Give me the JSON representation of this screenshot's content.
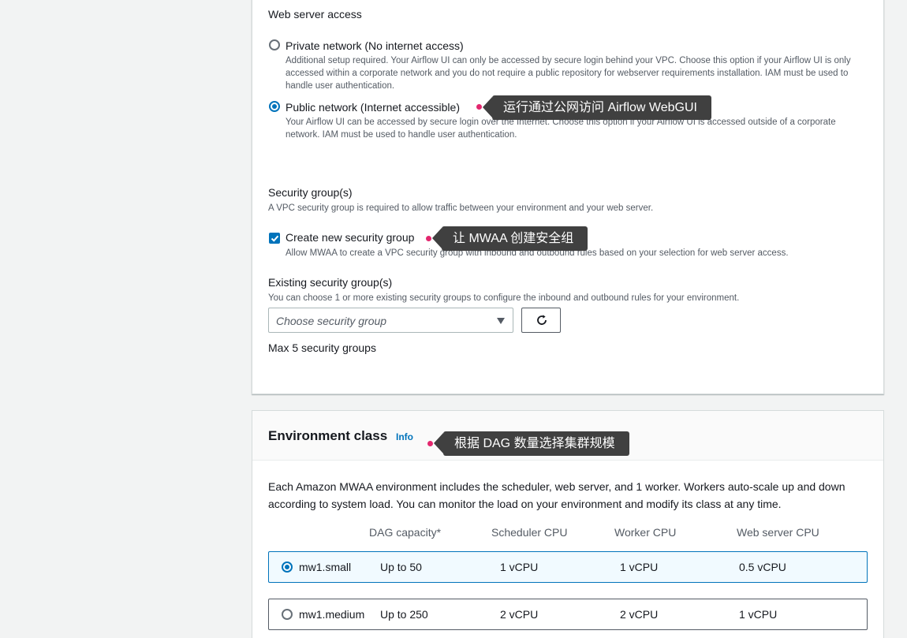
{
  "web_server_access": {
    "heading": "Web server access",
    "options": [
      {
        "label": "Private network (No internet access)",
        "description": "Additional setup required. Your Airflow UI can only be accessed by secure login behind your VPC. Choose this option if your Airflow UI is only accessed within a corporate network and you do not require a public repository for webserver requirements installation. IAM must be used to handle user authentication.",
        "selected": false
      },
      {
        "label": "Public network (Internet accessible)",
        "description": "Your Airflow UI can be accessed by secure login over the Internet. Choose this option if your Airflow UI is accessed outside of a corporate network. IAM must be used to handle user authentication.",
        "selected": true
      }
    ],
    "callout": "运行通过公网访问 Airflow WebGUI"
  },
  "security_groups": {
    "heading": "Security group(s)",
    "description": "A VPC security group is required to allow traffic between your environment and your web server.",
    "create_new": {
      "label": "Create new security group",
      "description": "Allow MWAA to create a VPC security group with inbound and outbound rules based on your selection for web server access.",
      "checked": true
    },
    "callout": "让 MWAA 创建安全组",
    "existing": {
      "heading": "Existing security group(s)",
      "description": "You can choose 1 or more existing security groups to configure the inbound and outbound rules for your environment.",
      "placeholder": "Choose security group",
      "refresh_icon": "refresh-icon",
      "caret_icon": "caret-down-icon",
      "max_note": "Max 5 security groups"
    }
  },
  "environment_class": {
    "title": "Environment class",
    "info_link": "Info",
    "callout": "根据 DAG 数量选择集群规模",
    "description": "Each Amazon MWAA environment includes the scheduler, web server, and 1 worker. Workers auto-scale up and down according to system load. You can monitor the load on your environment and modify its class at any time.",
    "columns": [
      "DAG capacity*",
      "Scheduler CPU",
      "Worker CPU",
      "Web server CPU"
    ],
    "rows": [
      {
        "name": "mw1.small",
        "dag_capacity": "Up to 50",
        "scheduler_cpu": "1 vCPU",
        "worker_cpu": "1 vCPU",
        "webserver_cpu": "0.5 vCPU",
        "selected": true
      },
      {
        "name": "mw1.medium",
        "dag_capacity": "Up to 250",
        "scheduler_cpu": "2 vCPU",
        "worker_cpu": "2 vCPU",
        "webserver_cpu": "1 vCPU",
        "selected": false
      }
    ]
  },
  "colors": {
    "accent": "#0073bb",
    "callout_bg": "#404040",
    "callout_dot": "#e3276e",
    "page_bg": "#f2f3f3"
  }
}
